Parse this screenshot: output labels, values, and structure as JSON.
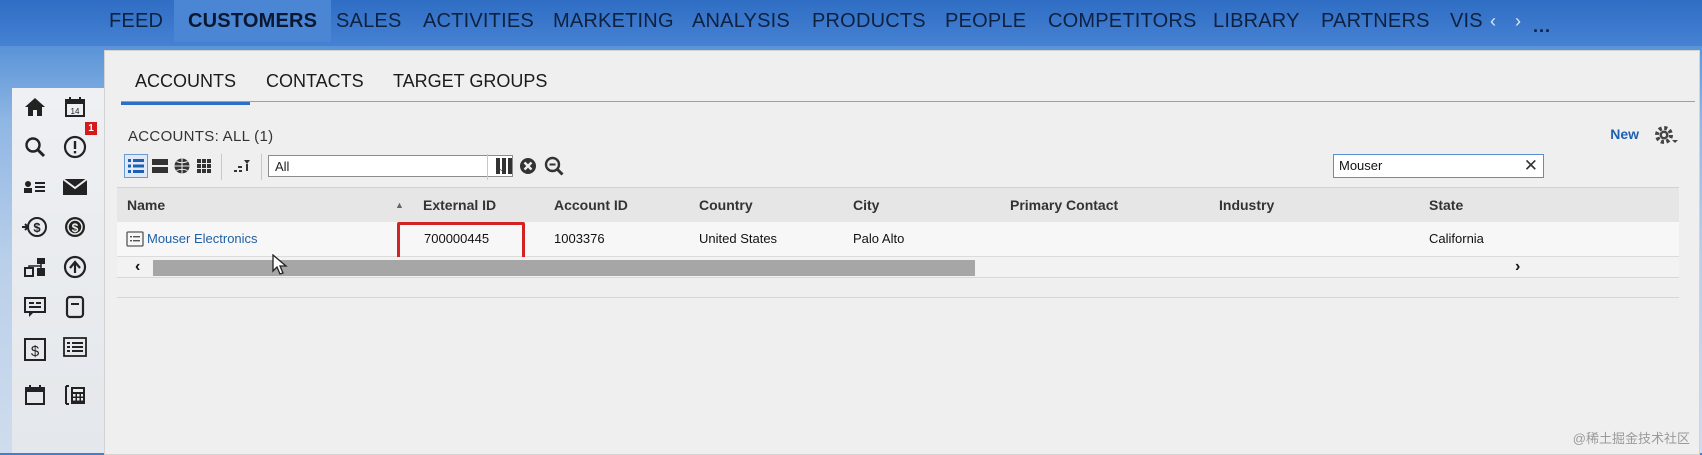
{
  "top_nav": {
    "items": [
      "FEED",
      "CUSTOMERS",
      "SALES",
      "ACTIVITIES",
      "MARKETING",
      "ANALYSIS",
      "PRODUCTS",
      "PEOPLE",
      "COMPETITORS",
      "LIBRARY",
      "PARTNERS",
      "VIS"
    ],
    "active": "CUSTOMERS",
    "more_label": "..."
  },
  "left_rail": {
    "icons": [
      "home-icon",
      "calendar-icon",
      "search-icon",
      "alert-icon",
      "contacts-list-icon",
      "mail-icon",
      "money-transfer-icon",
      "dollar-circle-icon",
      "org-chart-icon",
      "refresh-circle-icon",
      "chat-icon",
      "notebook-icon",
      "invoice-icon",
      "list-icon",
      "calendar-small-icon",
      "calculator-icon"
    ],
    "alert_badge": "1"
  },
  "sub_tabs": {
    "items": [
      "ACCOUNTS",
      "CONTACTS",
      "TARGET GROUPS"
    ],
    "active": "ACCOUNTS"
  },
  "list": {
    "title": "ACCOUNTS: ALL (1)",
    "new_label": "New",
    "filter_value": "All",
    "search_value": "Mouser"
  },
  "table": {
    "columns": [
      "Name",
      "External ID",
      "Account ID",
      "Country",
      "City",
      "Primary Contact",
      "Industry",
      "State"
    ],
    "rows": [
      {
        "name": "Mouser Electronics",
        "external_id": "700000445",
        "account_id": "1003376",
        "country": "United States",
        "city": "Palo Alto",
        "primary_contact": "",
        "industry": "",
        "state": "California"
      }
    ]
  },
  "watermark": "@稀土掘金技术社区"
}
